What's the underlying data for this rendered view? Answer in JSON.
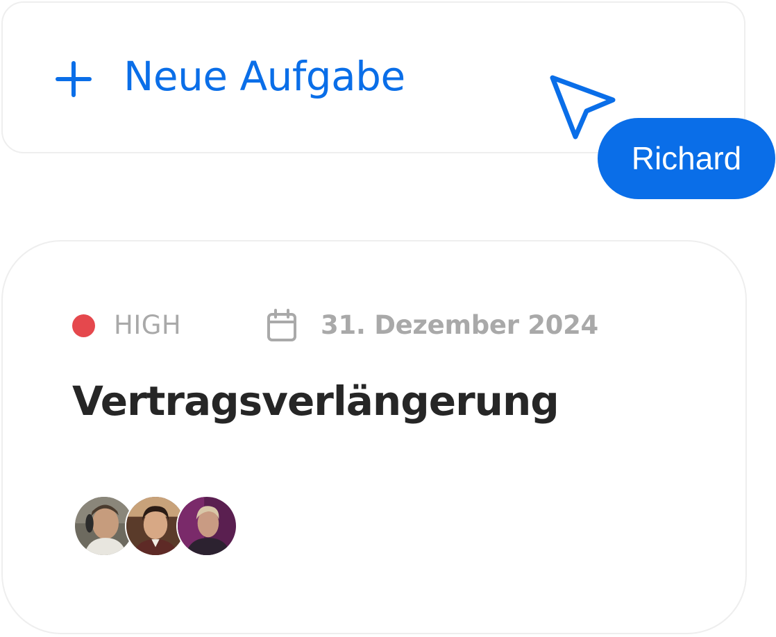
{
  "new_task": {
    "label": "Neue Aufgabe",
    "icon": "plus-icon"
  },
  "cursor": {
    "user_name": "Richard",
    "icon": "pointer-cursor-icon"
  },
  "task": {
    "priority": "HIGH",
    "priority_color": "#e5484d",
    "due_date": "31. Dezember 2024",
    "due_icon": "calendar-icon",
    "title": "Vertragsverlängerung",
    "assignees": [
      {
        "avatar": "avatar-photo"
      },
      {
        "avatar": "avatar-photo"
      },
      {
        "avatar": "avatar-photo"
      }
    ]
  },
  "colors": {
    "accent": "#0a6ee8",
    "muted_text": "#a9a9a9",
    "title_text": "#262626",
    "card_border": "#eeeeee"
  }
}
